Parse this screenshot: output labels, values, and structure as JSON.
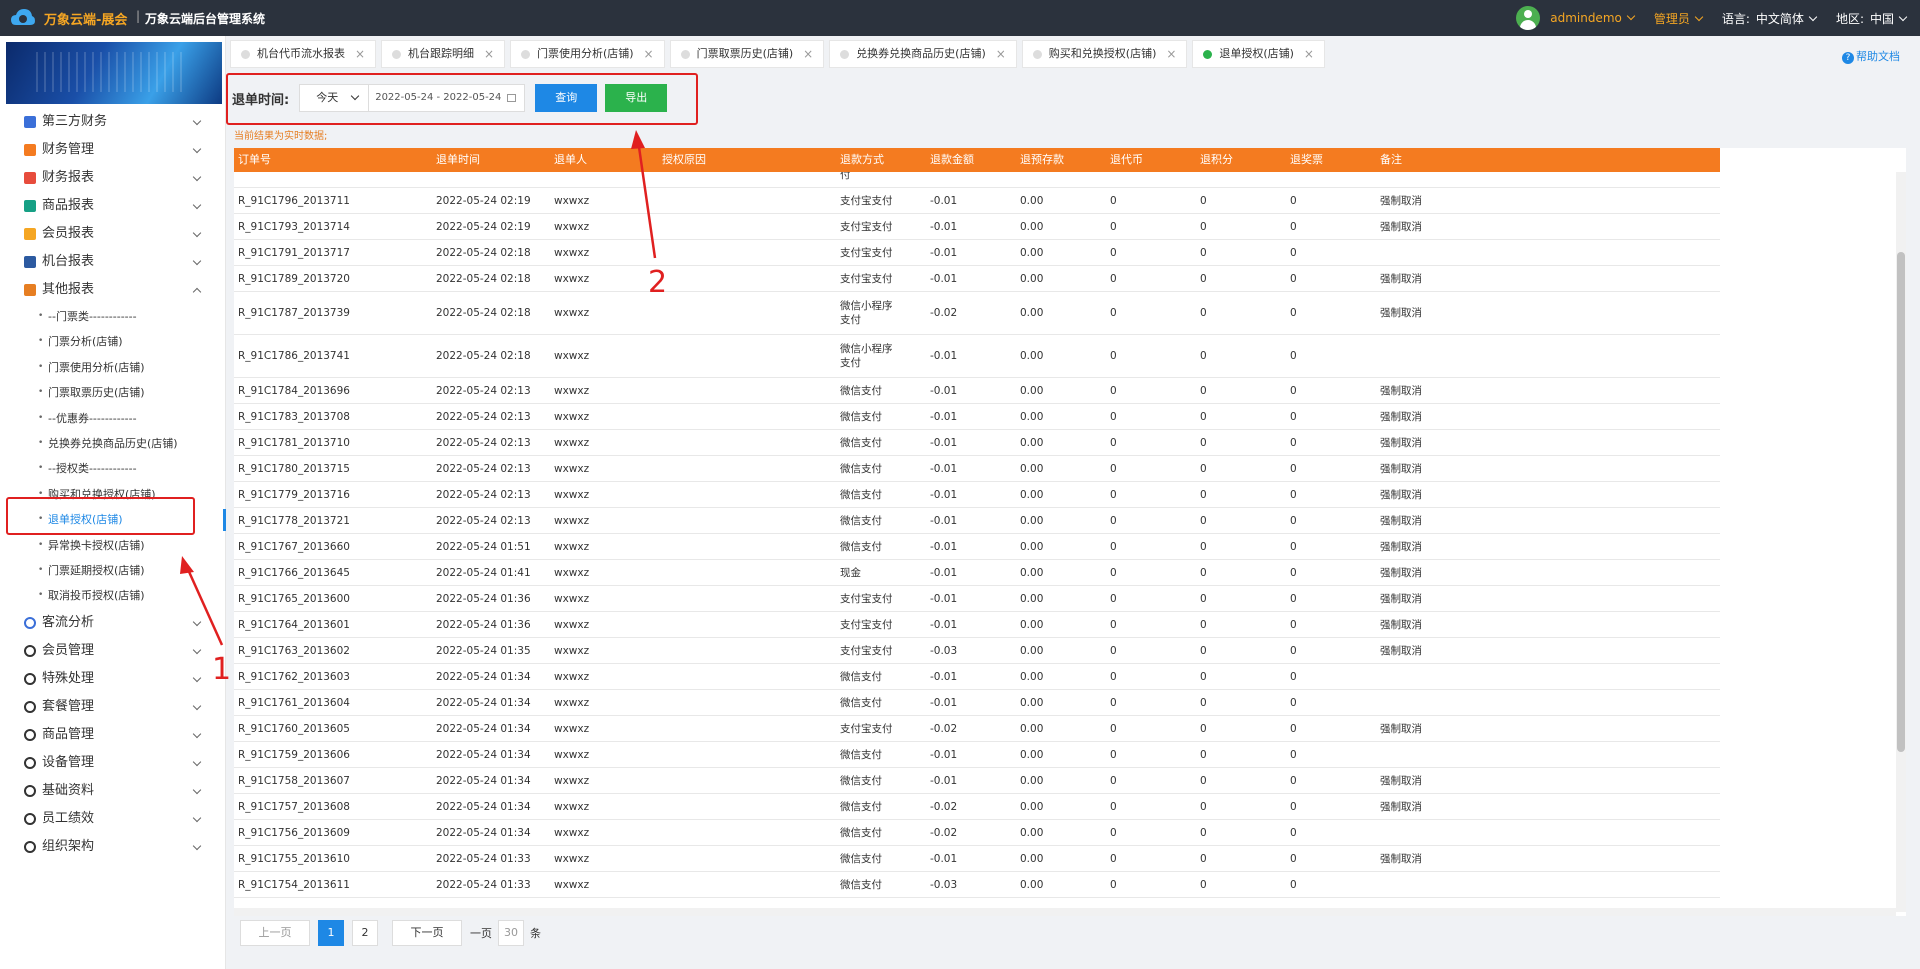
{
  "header": {
    "brand": "万象云端-展会",
    "separator": "|",
    "system_name": "万象云端后台管理系统",
    "user": "admindemo",
    "role": "管理员",
    "language_label": "语言:",
    "language_value": "中文简体",
    "region_label": "地区:",
    "region_value": "中国"
  },
  "sidebar": {
    "menu_top": [
      {
        "label": "第三方财务",
        "icon": "ledger-icon",
        "color": "#3b6fd8"
      },
      {
        "label": "财务管理",
        "icon": "finance-icon",
        "color": "#f47b20"
      },
      {
        "label": "财务报表",
        "icon": "report-icon",
        "color": "#e74c3c"
      },
      {
        "label": "商品报表",
        "icon": "goods-report-icon",
        "color": "#16a085"
      },
      {
        "label": "会员报表",
        "icon": "member-report-icon",
        "color": "#f5a623"
      },
      {
        "label": "机台报表",
        "icon": "machine-report-icon",
        "color": "#2c5aa0"
      },
      {
        "label": "其他报表",
        "icon": "layers-icon",
        "color": "#e67e22"
      }
    ],
    "submenu": [
      "--门票类------------",
      "门票分析(店铺)",
      "门票使用分析(店铺)",
      "门票取票历史(店铺)",
      "--优惠券------------",
      "兑换券兑换商品历史(店铺)",
      "--授权类------------",
      "购买和兑换授权(店铺)",
      "退单授权(店铺)",
      "异常换卡授权(店铺)",
      "门票延期授权(店铺)",
      "取消投币授权(店铺)"
    ],
    "active_submenu_index": 8,
    "menu_bottom": [
      {
        "label": "客流分析",
        "icon": "traffic-icon"
      },
      {
        "label": "会员管理",
        "icon": "user-icon"
      },
      {
        "label": "特殊处理",
        "icon": "warning-icon"
      },
      {
        "label": "套餐管理",
        "icon": "package-icon"
      },
      {
        "label": "商品管理",
        "icon": "swap-icon"
      },
      {
        "label": "设备管理",
        "icon": "device-icon"
      },
      {
        "label": "基础资料",
        "icon": "book-icon"
      },
      {
        "label": "员工绩效",
        "icon": "gear-icon"
      },
      {
        "label": "组织架构",
        "icon": "org-icon"
      }
    ]
  },
  "tabs": [
    {
      "label": "机台代币流水报表",
      "active": false
    },
    {
      "label": "机台跟踪明细",
      "active": false
    },
    {
      "label": "门票使用分析(店铺)",
      "active": false
    },
    {
      "label": "门票取票历史(店铺)",
      "active": false
    },
    {
      "label": "兑换券兑换商品历史(店铺)",
      "active": false
    },
    {
      "label": "购买和兑换授权(店铺)",
      "active": false
    },
    {
      "label": "退单授权(店铺)",
      "active": true
    }
  ],
  "help_label": "帮助文档",
  "filter": {
    "label": "退单时间:",
    "period": "今天",
    "date_range": "2022-05-24 - 2022-05-24",
    "query_button": "查询",
    "export_button": "导出"
  },
  "note": "当前结果为实时数据;",
  "table": {
    "columns": [
      "订单号",
      "退单时间",
      "退单人",
      "授权原因",
      "退款方式",
      "退款金额",
      "退预存款",
      "退代币",
      "退积分",
      "退奖票",
      "备注"
    ],
    "partial_row_payment": "付",
    "rows": [
      [
        "R_91C1796_2013711",
        "2022-05-24 02:19",
        "wxwxz",
        "",
        "支付宝支付",
        "-0.01",
        "0.00",
        "0",
        "0",
        "0",
        "强制取消"
      ],
      [
        "R_91C1793_2013714",
        "2022-05-24 02:19",
        "wxwxz",
        "",
        "支付宝支付",
        "-0.01",
        "0.00",
        "0",
        "0",
        "0",
        "强制取消"
      ],
      [
        "R_91C1791_2013717",
        "2022-05-24 02:18",
        "wxwxz",
        "",
        "支付宝支付",
        "-0.01",
        "0.00",
        "0",
        "0",
        "0",
        ""
      ],
      [
        "R_91C1789_2013720",
        "2022-05-24 02:18",
        "wxwxz",
        "",
        "支付宝支付",
        "-0.01",
        "0.00",
        "0",
        "0",
        "0",
        "强制取消"
      ],
      [
        "R_91C1787_2013739",
        "2022-05-24 02:18",
        "wxwxz",
        "",
        "微信小程序支付",
        "-0.02",
        "0.00",
        "0",
        "0",
        "0",
        "强制取消"
      ],
      [
        "R_91C1786_2013741",
        "2022-05-24 02:18",
        "wxwxz",
        "",
        "微信小程序支付",
        "-0.01",
        "0.00",
        "0",
        "0",
        "0",
        ""
      ],
      [
        "R_91C1784_2013696",
        "2022-05-24 02:13",
        "wxwxz",
        "",
        "微信支付",
        "-0.01",
        "0.00",
        "0",
        "0",
        "0",
        "强制取消"
      ],
      [
        "R_91C1783_2013708",
        "2022-05-24 02:13",
        "wxwxz",
        "",
        "微信支付",
        "-0.01",
        "0.00",
        "0",
        "0",
        "0",
        "强制取消"
      ],
      [
        "R_91C1781_2013710",
        "2022-05-24 02:13",
        "wxwxz",
        "",
        "微信支付",
        "-0.01",
        "0.00",
        "0",
        "0",
        "0",
        "强制取消"
      ],
      [
        "R_91C1780_2013715",
        "2022-05-24 02:13",
        "wxwxz",
        "",
        "微信支付",
        "-0.01",
        "0.00",
        "0",
        "0",
        "0",
        "强制取消"
      ],
      [
        "R_91C1779_2013716",
        "2022-05-24 02:13",
        "wxwxz",
        "",
        "微信支付",
        "-0.01",
        "0.00",
        "0",
        "0",
        "0",
        "强制取消"
      ],
      [
        "R_91C1778_2013721",
        "2022-05-24 02:13",
        "wxwxz",
        "",
        "微信支付",
        "-0.01",
        "0.00",
        "0",
        "0",
        "0",
        "强制取消"
      ],
      [
        "R_91C1767_2013660",
        "2022-05-24 01:51",
        "wxwxz",
        "",
        "微信支付",
        "-0.01",
        "0.00",
        "0",
        "0",
        "0",
        "强制取消"
      ],
      [
        "R_91C1766_2013645",
        "2022-05-24 01:41",
        "wxwxz",
        "",
        "现金",
        "-0.01",
        "0.00",
        "0",
        "0",
        "0",
        "强制取消"
      ],
      [
        "R_91C1765_2013600",
        "2022-05-24 01:36",
        "wxwxz",
        "",
        "支付宝支付",
        "-0.01",
        "0.00",
        "0",
        "0",
        "0",
        "强制取消"
      ],
      [
        "R_91C1764_2013601",
        "2022-05-24 01:36",
        "wxwxz",
        "",
        "支付宝支付",
        "-0.01",
        "0.00",
        "0",
        "0",
        "0",
        "强制取消"
      ],
      [
        "R_91C1763_2013602",
        "2022-05-24 01:35",
        "wxwxz",
        "",
        "支付宝支付",
        "-0.03",
        "0.00",
        "0",
        "0",
        "0",
        "强制取消"
      ],
      [
        "R_91C1762_2013603",
        "2022-05-24 01:34",
        "wxwxz",
        "",
        "微信支付",
        "-0.01",
        "0.00",
        "0",
        "0",
        "0",
        ""
      ],
      [
        "R_91C1761_2013604",
        "2022-05-24 01:34",
        "wxwxz",
        "",
        "微信支付",
        "-0.01",
        "0.00",
        "0",
        "0",
        "0",
        ""
      ],
      [
        "R_91C1760_2013605",
        "2022-05-24 01:34",
        "wxwxz",
        "",
        "支付宝支付",
        "-0.02",
        "0.00",
        "0",
        "0",
        "0",
        "强制取消"
      ],
      [
        "R_91C1759_2013606",
        "2022-05-24 01:34",
        "wxwxz",
        "",
        "微信支付",
        "-0.01",
        "0.00",
        "0",
        "0",
        "0",
        ""
      ],
      [
        "R_91C1758_2013607",
        "2022-05-24 01:34",
        "wxwxz",
        "",
        "微信支付",
        "-0.01",
        "0.00",
        "0",
        "0",
        "0",
        "强制取消"
      ],
      [
        "R_91C1757_2013608",
        "2022-05-24 01:34",
        "wxwxz",
        "",
        "微信支付",
        "-0.02",
        "0.00",
        "0",
        "0",
        "0",
        "强制取消"
      ],
      [
        "R_91C1756_2013609",
        "2022-05-24 01:34",
        "wxwxz",
        "",
        "微信支付",
        "-0.02",
        "0.00",
        "0",
        "0",
        "0",
        ""
      ],
      [
        "R_91C1755_2013610",
        "2022-05-24 01:33",
        "wxwxz",
        "",
        "微信支付",
        "-0.01",
        "0.00",
        "0",
        "0",
        "0",
        "强制取消"
      ],
      [
        "R_91C1754_2013611",
        "2022-05-24 01:33",
        "wxwxz",
        "",
        "微信支付",
        "-0.03",
        "0.00",
        "0",
        "0",
        "0",
        ""
      ]
    ]
  },
  "pager": {
    "prev": "上一页",
    "pages": [
      "1",
      "2"
    ],
    "current": "1",
    "next": "下一页",
    "size_prefix": "一页",
    "size_value": "30",
    "size_suffix": "条"
  },
  "annotations": {
    "label_1": "1",
    "label_2": "2",
    "color": "#e02020"
  }
}
